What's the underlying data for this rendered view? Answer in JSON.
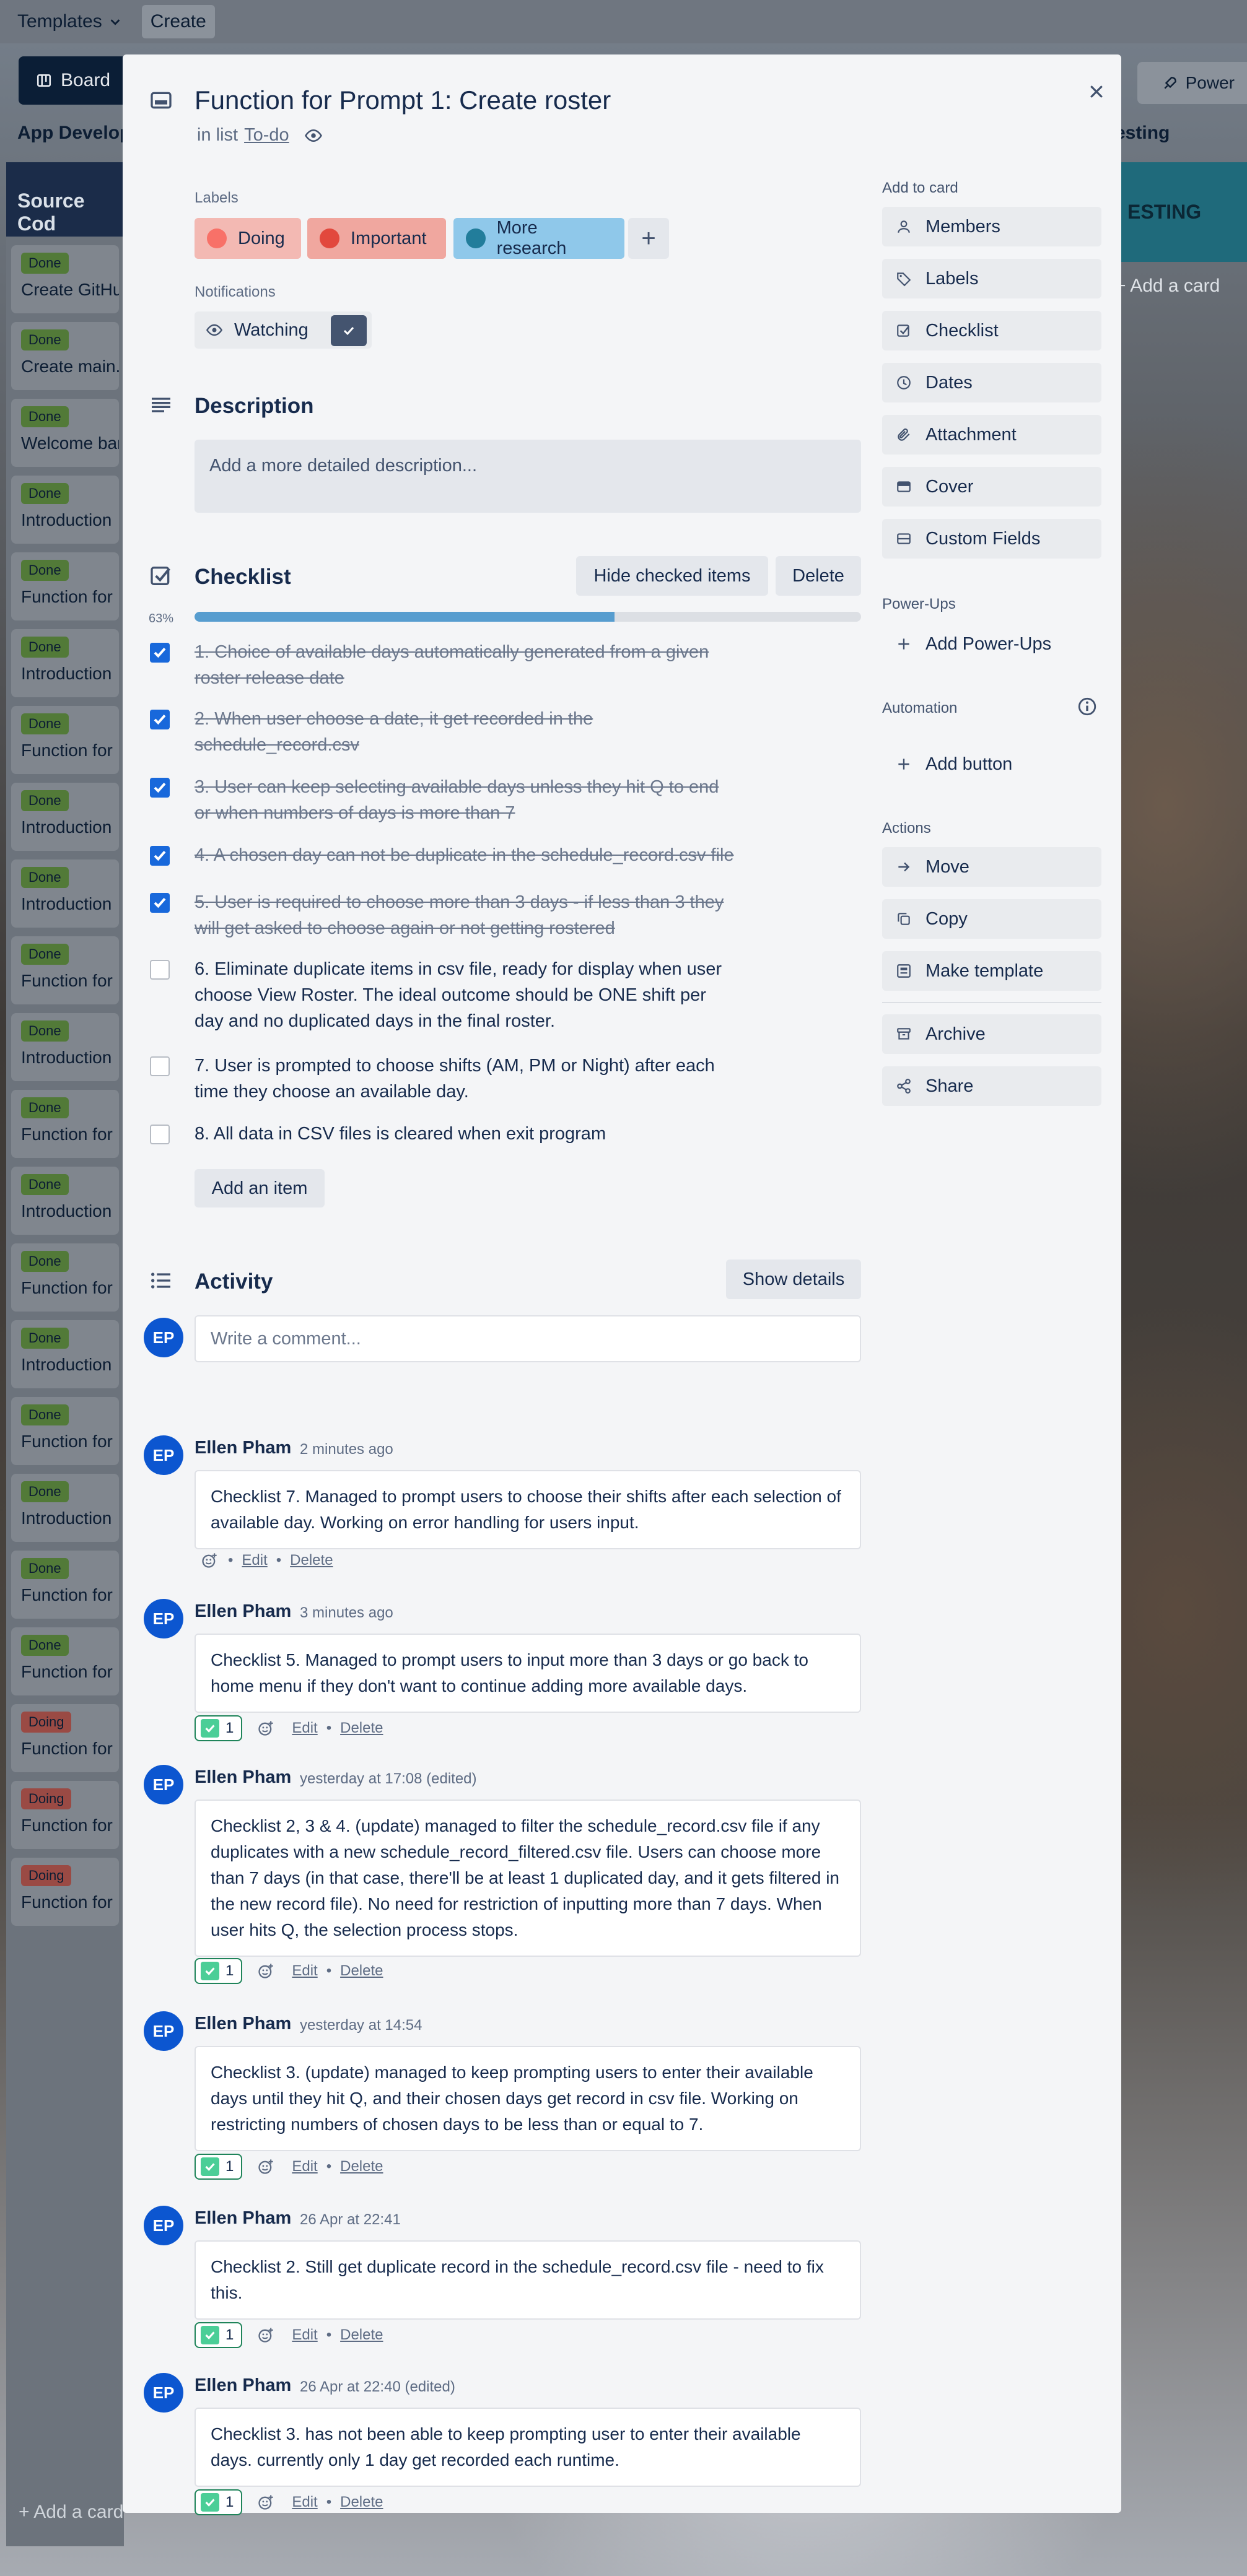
{
  "topbar": {
    "templates": "Templates",
    "create": "Create"
  },
  "boardbar": {
    "board": "Board",
    "powerups": "Power"
  },
  "board": {
    "left_list_title": "App Develop",
    "left_list_header": "Source Cod",
    "right_list_title": "esting",
    "right_list_header": "ESTING",
    "add_card": "+ Add a card",
    "bottom_add": "+ Add a card",
    "left_cards": [
      {
        "label": "Done",
        "title": "Create GitHu"
      },
      {
        "label": "Done",
        "title": "Create main.p"
      },
      {
        "label": "Done",
        "title": "Welcome ban"
      },
      {
        "label": "Done",
        "title": "Introduction"
      },
      {
        "label": "Done",
        "title": "Function for"
      },
      {
        "label": "Done",
        "title": "Introduction"
      },
      {
        "label": "Done",
        "title": "Function for"
      },
      {
        "label": "Done",
        "title": "Introduction"
      },
      {
        "label": "Done",
        "title": "Introduction"
      },
      {
        "label": "Done",
        "title": "Function for"
      },
      {
        "label": "Done",
        "title": "Introduction"
      },
      {
        "label": "Done",
        "title": "Function for"
      },
      {
        "label": "Done",
        "title": "Introduction"
      },
      {
        "label": "Done",
        "title": "Function for"
      },
      {
        "label": "Done",
        "title": "Introduction"
      },
      {
        "label": "Done",
        "title": "Function for"
      },
      {
        "label": "Done",
        "title": "Introduction"
      },
      {
        "label": "Done",
        "title": "Function for"
      },
      {
        "label": "Done",
        "title": "Function for"
      },
      {
        "label": "Doing",
        "title": "Function for"
      },
      {
        "label": "Doing",
        "title": "Function for"
      },
      {
        "label": "Doing",
        "title": "Function for"
      }
    ]
  },
  "card": {
    "title": "Function for Prompt 1: Create roster",
    "in_list_prefix": "in list",
    "list_name": "To-do",
    "labels_heading": "Labels",
    "labels": [
      {
        "name": "Doing",
        "bg": "#f3b9b3",
        "dot": "#f87168"
      },
      {
        "name": "Important",
        "bg": "#f0a79f",
        "dot": "#e2483d"
      },
      {
        "name": "More research",
        "bg": "#8fc8ea",
        "dot": "#227d9b"
      }
    ],
    "notifications_heading": "Notifications",
    "watching": "Watching",
    "description_heading": "Description",
    "description_placeholder": "Add a more detailed description...",
    "checklist": {
      "heading": "Checklist",
      "hide_checked": "Hide checked items",
      "delete": "Delete",
      "progress_label": "63%",
      "progress": 0.63,
      "items": [
        {
          "text": "1. Choice of available days automatically generated from a given roster release date",
          "checked": true
        },
        {
          "text": "2. When user choose a date, it get recorded in the schedule_record.csv",
          "checked": true
        },
        {
          "text": "3. User can keep selecting available days unless they hit Q to end or when numbers of days is more than 7",
          "checked": true
        },
        {
          "text": "4. A chosen day can not be duplicate in the schedule_record.csv file",
          "checked": true
        },
        {
          "text": "5. User is required to choose more than 3 days - if less than 3 they will get asked to choose again or not getting rostered",
          "checked": true
        },
        {
          "text": "6. Eliminate duplicate items in csv file, ready for display when user choose View Roster. The ideal outcome should be ONE shift per day and no duplicated days in the final roster.",
          "checked": false
        },
        {
          "text": "7. User is prompted to choose shifts (AM, PM or Night) after each time they choose an available day.",
          "checked": false
        },
        {
          "text": "8. All data in CSV files is cleared when exit program",
          "checked": false
        }
      ],
      "add_item": "Add an item"
    },
    "activity": {
      "heading": "Activity",
      "show_details": "Show details",
      "comment_placeholder": "Write a comment...",
      "avatar_initials": "EP",
      "edit": "Edit",
      "delete": "Delete",
      "dot": "•",
      "comments": [
        {
          "author": "Ellen Pham",
          "time": "2 minutes ago",
          "text": "Checklist 7. Managed to prompt users to choose their shifts after each selection of available day. Working on error handling for users input.",
          "reactions": ""
        },
        {
          "author": "Ellen Pham",
          "time": "3 minutes ago",
          "text": "Checklist 5. Managed to prompt users to input more than 3 days or go back to home menu if they don't want to continue adding more available days.",
          "reactions": "1"
        },
        {
          "author": "Ellen Pham",
          "time": "yesterday at 17:08 (edited)",
          "text": "Checklist 2, 3 & 4. (update) managed to filter the schedule_record.csv file if any duplicates with a new schedule_record_filtered.csv file. Users can choose more than 7 days (in that case, there'll be at least 1 duplicated day, and it gets filtered in the new record file). No need for restriction of inputting more than 7 days. When user hits Q, the selection process stops.",
          "reactions": "1"
        },
        {
          "author": "Ellen Pham",
          "time": "yesterday at 14:54",
          "text": "Checklist 3. (update) managed to keep prompting users to enter their available days until they hit Q, and their chosen days get record in csv file. Working on restricting numbers of chosen days to be less than or equal to 7.",
          "reactions": "1"
        },
        {
          "author": "Ellen Pham",
          "time": "26 Apr at 22:41",
          "text": "Checklist 2. Still get duplicate record in the schedule_record.csv file - need to fix this.",
          "reactions": "1"
        },
        {
          "author": "Ellen Pham",
          "time": "26 Apr at 22:40 (edited)",
          "text": "Checklist 3. has not been able to keep prompting user to enter their available days. currently only 1 day get recorded each runtime.",
          "reactions": "1"
        }
      ]
    },
    "sidebar": {
      "add_to_card": "Add to card",
      "add_items": [
        "Members",
        "Labels",
        "Checklist",
        "Dates",
        "Attachment",
        "Cover",
        "Custom Fields"
      ],
      "powerups_heading": "Power-Ups",
      "add_powerups": "Add Power-Ups",
      "automation_heading": "Automation",
      "add_button": "Add button",
      "actions_heading": "Actions",
      "action_items": [
        "Move",
        "Copy",
        "Make template",
        "Archive",
        "Share"
      ]
    }
  }
}
